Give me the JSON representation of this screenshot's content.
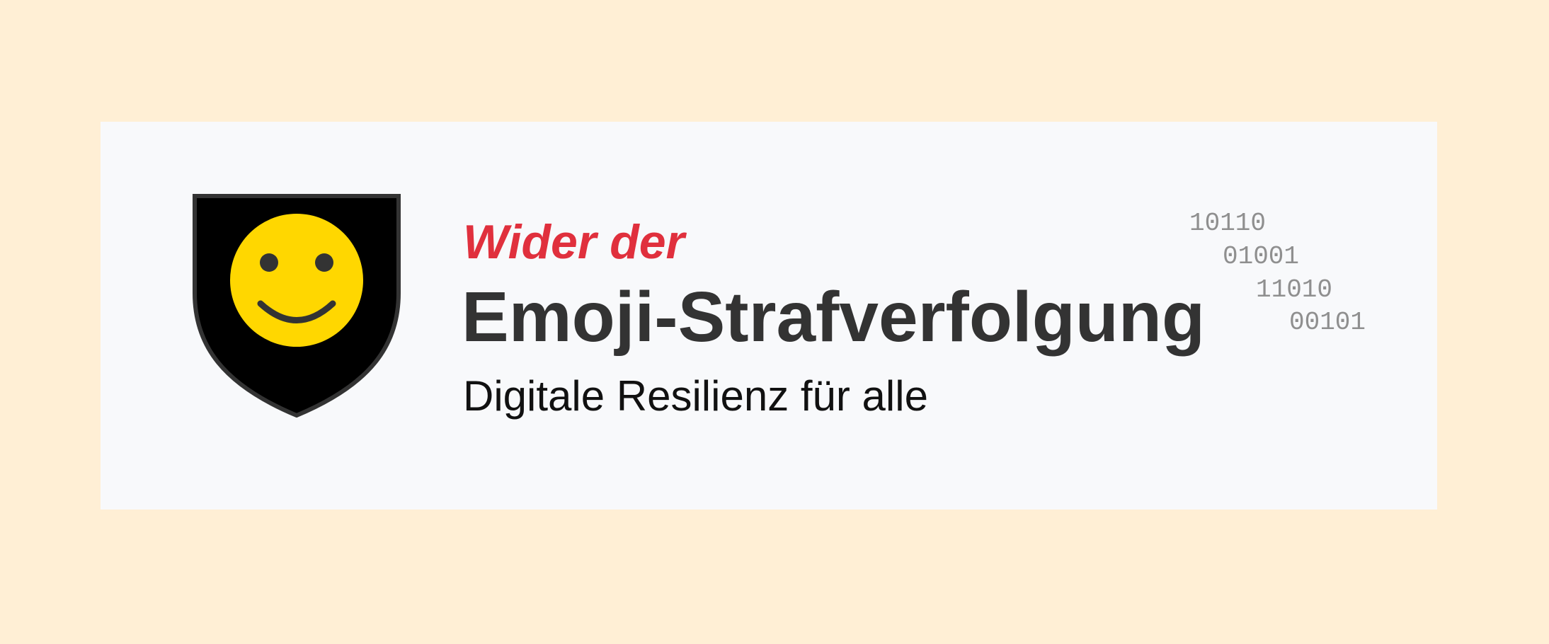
{
  "colors": {
    "page_background": "#ffefd5",
    "banner_background": "#f8f9fb",
    "kicker": "#e0303d",
    "title": "#333333",
    "subtitle": "#111111",
    "binary": "#8f8f8f",
    "shield_fill": "#000000",
    "shield_border": "#333333",
    "smiley": "#ffd700"
  },
  "logo": {
    "icon": "shield-smiley-icon"
  },
  "headline": {
    "kicker": "Wider der",
    "title": "Emoji-Strafverfolgung",
    "subtitle": "Digitale Resilienz für alle"
  },
  "binary_lines": [
    "10110",
    "01001",
    "11010",
    "00101"
  ]
}
